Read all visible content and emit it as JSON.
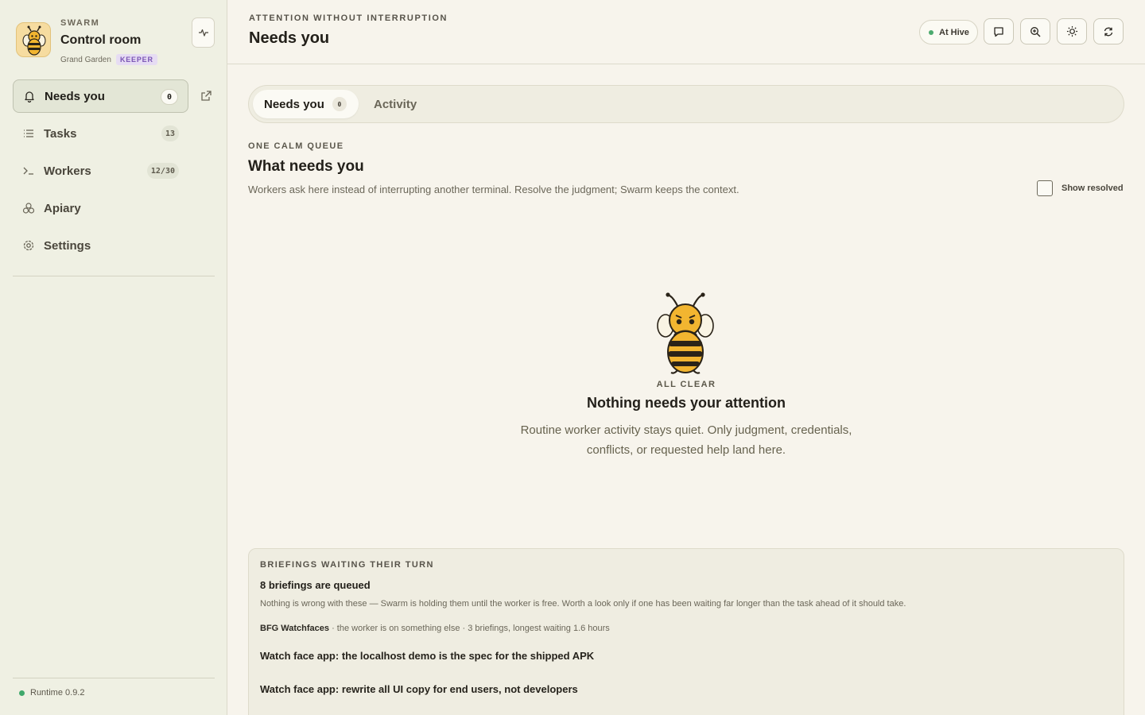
{
  "sidebar": {
    "brand": {
      "eyebrow": "SWARM",
      "title": "Control room",
      "subtitle": "Grand Garden",
      "role_badge": "KEEPER"
    },
    "items": [
      {
        "label": "Needs you",
        "count": "0",
        "icon": "bell-icon",
        "active": true
      },
      {
        "label": "Tasks",
        "count": "13",
        "icon": "list-icon"
      },
      {
        "label": "Workers",
        "count": "12/30",
        "icon": "terminal-icon"
      },
      {
        "label": "Apiary",
        "count": "",
        "icon": "hive-cells-icon"
      },
      {
        "label": "Settings",
        "count": "",
        "icon": "gear-icon"
      }
    ],
    "runtime": "Runtime 0.9.2"
  },
  "header": {
    "eyebrow": "ATTENTION WITHOUT INTERRUPTION",
    "title": "Needs you",
    "status_pill": "At Hive",
    "tools": [
      "chat-icon",
      "zoom-in-icon",
      "sun-icon",
      "refresh-icon"
    ]
  },
  "main": {
    "tabs": [
      {
        "label": "Needs you",
        "count": "0",
        "active": true
      },
      {
        "label": "Activity"
      }
    ],
    "section": {
      "eyebrow": "ONE CALM QUEUE",
      "title": "What needs you",
      "description": "Workers ask here instead of interrupting another terminal. Resolve the judgment; Swarm keeps the context.",
      "show_resolved_label": "Show resolved",
      "show_resolved_checked": false
    },
    "empty_state": {
      "eyebrow": "ALL CLEAR",
      "title": "Nothing needs your attention",
      "description": "Routine worker activity stays quiet. Only judgment, credentials, conflicts, or requested help land here."
    },
    "briefings": {
      "eyebrow": "BRIEFINGS WAITING THEIR TURN",
      "title": "8 briefings are queued",
      "description": "Nothing is wrong with these — Swarm is holding them until the worker is free. Worth a look only if one has been waiting far longer than the task ahead of it should take.",
      "group_name": "BFG Watchfaces",
      "group_meta": "· the worker is on something else · 3 briefings, longest waiting 1.6 hours",
      "items": [
        "Watch face app: the localhost demo is the spec for the shipped APK",
        "Watch face app: rewrite all UI copy for end users, not developers"
      ]
    }
  },
  "colors": {
    "accent_green": "#3fa86b",
    "keeper_purple": "#7a55b4",
    "bee_yellow": "#f2b530"
  }
}
